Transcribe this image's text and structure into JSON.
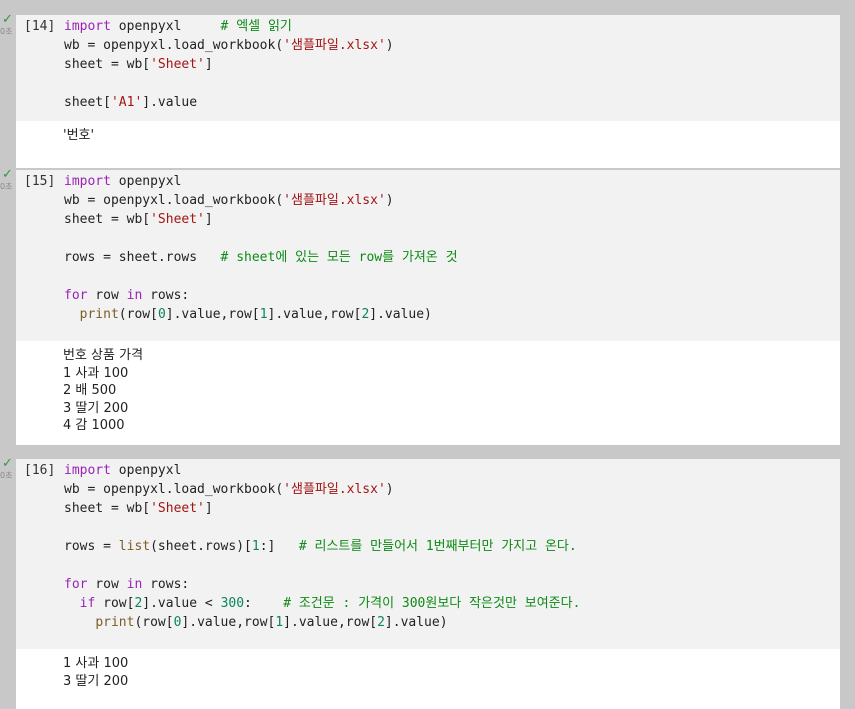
{
  "cells": [
    {
      "exec_count": "[14]",
      "time": "0초",
      "lines": [
        [
          {
            "t": "import",
            "c": "kw"
          },
          {
            "t": " openpyxl     ",
            "c": ""
          },
          {
            "t": "# 엑셀 읽기",
            "c": "cmt"
          }
        ],
        [
          {
            "t": "wb = openpyxl.load_workbook(",
            "c": ""
          },
          {
            "t": "'샘플파일.xlsx'",
            "c": "str"
          },
          {
            "t": ")",
            "c": ""
          }
        ],
        [
          {
            "t": "sheet = wb[",
            "c": ""
          },
          {
            "t": "'Sheet'",
            "c": "str"
          },
          {
            "t": "]",
            "c": ""
          }
        ],
        [],
        [
          {
            "t": "sheet[",
            "c": ""
          },
          {
            "t": "'A1'",
            "c": "str"
          },
          {
            "t": "].value",
            "c": ""
          }
        ]
      ],
      "output": [
        "'번호'"
      ]
    },
    {
      "exec_count": "[15]",
      "time": "0초",
      "lines": [
        [
          {
            "t": "import",
            "c": "kw"
          },
          {
            "t": " openpyxl",
            "c": ""
          }
        ],
        [
          {
            "t": "wb = openpyxl.load_workbook(",
            "c": ""
          },
          {
            "t": "'샘플파일.xlsx'",
            "c": "str"
          },
          {
            "t": ")",
            "c": ""
          }
        ],
        [
          {
            "t": "sheet = wb[",
            "c": ""
          },
          {
            "t": "'Sheet'",
            "c": "str"
          },
          {
            "t": "]",
            "c": ""
          }
        ],
        [],
        [
          {
            "t": "rows = sheet.rows   ",
            "c": ""
          },
          {
            "t": "# sheet에 있는 모든 row를 가져온 것",
            "c": "cmt"
          }
        ],
        [],
        [
          {
            "t": "for",
            "c": "kw"
          },
          {
            "t": " row ",
            "c": ""
          },
          {
            "t": "in",
            "c": "kw"
          },
          {
            "t": " rows:",
            "c": ""
          }
        ],
        [
          {
            "t": "  ",
            "c": ""
          },
          {
            "t": "print",
            "c": "fn"
          },
          {
            "t": "(row[",
            "c": ""
          },
          {
            "t": "0",
            "c": "num"
          },
          {
            "t": "].value,row[",
            "c": ""
          },
          {
            "t": "1",
            "c": "num"
          },
          {
            "t": "].value,row[",
            "c": ""
          },
          {
            "t": "2",
            "c": "num"
          },
          {
            "t": "].value)",
            "c": ""
          }
        ]
      ],
      "output": [
        "번호 상품 가격",
        "1 사과 100",
        "2 배 500",
        "3 딸기 200",
        "4 감 1000"
      ]
    },
    {
      "exec_count": "[16]",
      "time": "0초",
      "lines": [
        [
          {
            "t": "import",
            "c": "kw"
          },
          {
            "t": " openpyxl",
            "c": ""
          }
        ],
        [
          {
            "t": "wb = openpyxl.load_workbook(",
            "c": ""
          },
          {
            "t": "'샘플파일.xlsx'",
            "c": "str"
          },
          {
            "t": ")",
            "c": ""
          }
        ],
        [
          {
            "t": "sheet = wb[",
            "c": ""
          },
          {
            "t": "'Sheet'",
            "c": "str"
          },
          {
            "t": "]",
            "c": ""
          }
        ],
        [],
        [
          {
            "t": "rows = ",
            "c": ""
          },
          {
            "t": "list",
            "c": "fn"
          },
          {
            "t": "(sheet.rows)[",
            "c": ""
          },
          {
            "t": "1",
            "c": "num"
          },
          {
            "t": ":]   ",
            "c": ""
          },
          {
            "t": "# 리스트를 만들어서 1번째부터만 가지고 온다.",
            "c": "cmt"
          }
        ],
        [],
        [
          {
            "t": "for",
            "c": "kw"
          },
          {
            "t": " row ",
            "c": ""
          },
          {
            "t": "in",
            "c": "kw"
          },
          {
            "t": " rows:",
            "c": ""
          }
        ],
        [
          {
            "t": "  ",
            "c": ""
          },
          {
            "t": "if",
            "c": "kw"
          },
          {
            "t": " row[",
            "c": ""
          },
          {
            "t": "2",
            "c": "num"
          },
          {
            "t": "].value < ",
            "c": ""
          },
          {
            "t": "300",
            "c": "num"
          },
          {
            "t": ":    ",
            "c": ""
          },
          {
            "t": "# 조건문 : 가격이 300원보다 작은것만 보여준다.",
            "c": "cmt"
          }
        ],
        [
          {
            "t": "    ",
            "c": ""
          },
          {
            "t": "print",
            "c": "fn"
          },
          {
            "t": "(row[",
            "c": ""
          },
          {
            "t": "0",
            "c": "num"
          },
          {
            "t": "].value,row[",
            "c": ""
          },
          {
            "t": "1",
            "c": "num"
          },
          {
            "t": "].value,row[",
            "c": ""
          },
          {
            "t": "2",
            "c": "num"
          },
          {
            "t": "].value)",
            "c": ""
          }
        ]
      ],
      "output": [
        "1 사과 100",
        "3 딸기 200"
      ]
    }
  ]
}
